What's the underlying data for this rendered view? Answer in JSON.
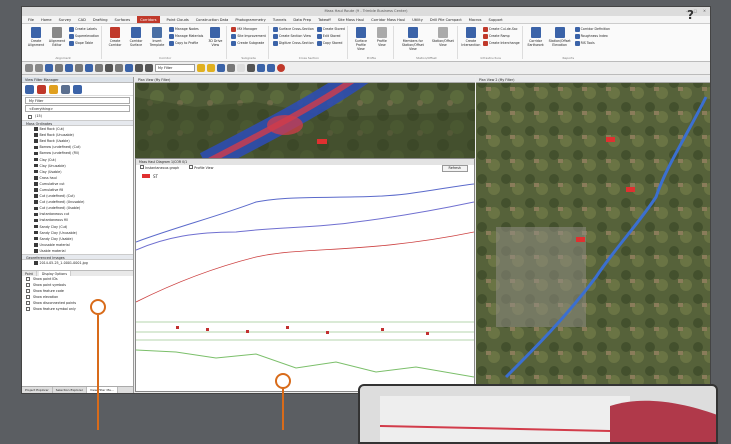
{
  "app": {
    "title": "Mass Haul Route (9 - Trimble Business Center)"
  },
  "menu": [
    "File",
    "Home",
    "Survey",
    "CAD",
    "Drafting",
    "Surfaces",
    "Corridors",
    "Point Clouds",
    "Construction Data",
    "Photogrammetry",
    "Tunnels",
    "Data Prep",
    "Takeoff",
    "Site Mass Haul",
    "Corridor Mass Haul",
    "Utility",
    "Drill Pile Compact",
    "Macros",
    "Support"
  ],
  "menu_active_index": 6,
  "help_label": "?",
  "ribbon": {
    "create_alignment": "Create Alignment",
    "alignment_editor": "Alignment Editor",
    "labels": [
      "Create Labels",
      "Superelevation",
      "Slope Table"
    ],
    "create_corridor": "Create Corridor",
    "corridor_surface": "Corridor Surface",
    "insert_template": "Insert Template",
    "nodes": [
      "Manage Nodes",
      "Manage Materials",
      "Copy to Profile"
    ],
    "drive_view": "3D Drive View",
    "mx": [
      "MX Manager",
      "Site Improvement",
      "Create Subgrade"
    ],
    "sections": [
      "Surface Cross-Section",
      "Create Section View",
      "Digitize Cross-Section"
    ],
    "stored": [
      "Create Stored",
      "Edit Stored",
      "Copy Stored"
    ],
    "surface_profile": "Surface Profile View",
    "profile_view": "Profile View",
    "members": "Members for Station/Offset View",
    "station_offset": "Station/Offset View",
    "create_intersection": "Create Intersection",
    "ramps": [
      "Create Cul-de-Sac",
      "Create Ramp",
      "Create Interchange"
    ],
    "corridor_earthwork": "Corridor Earthwork",
    "station_elevation": "Station/Offset Elevation",
    "reports": [
      "Corridor Definition",
      "Roughness Index",
      "RIS Tools"
    ],
    "groups": [
      "Alignment",
      "Corridor",
      "Subgrade",
      "Cross Section",
      "Profile",
      "Station/Offset",
      "Infrastructure",
      "Reports"
    ]
  },
  "toolbar": {
    "filter_value": "My Filter"
  },
  "left_panel": {
    "title": "View Filter Manager",
    "filter_label": "My Filter",
    "everything": "<Everything>",
    "first_item": "(15)",
    "group_materials": "Mass Ordinates",
    "materials": [
      "Bed Rock (Cut)",
      "Bed Rock (Unusable)",
      "Bed Rock (Usable)",
      "Borrow (undefined) (Cut)",
      "Borrow (undefined) (Fill)",
      "Clay (Cut)",
      "Clay (Unusable)",
      "Clay (Usable)",
      "Cross haul",
      "Cumulative cut",
      "Cumulative fill",
      "Cut (undefined) (Cut)",
      "Cut (undefined) (Unusable)",
      "Cut (undefined) (Usable)",
      "Instantaneous cut",
      "Instantaneous fill",
      "Sandy Clay (Cut)",
      "Sandy Clay (Unusable)",
      "Sandy Clay (Usable)",
      "Unusable material",
      "Usable material"
    ],
    "group_images": "Georeferenced Images",
    "image_item": "2014-05-25_1-0001-0001.jpg",
    "display_tabs": [
      "Point",
      "Display Options"
    ],
    "options": [
      "Show point IDs",
      "Show point symbols",
      "Show feature code",
      "Show elevation",
      "Show disconnected points",
      "Show feature symbol only"
    ],
    "bottom_tabs": [
      "Project Explorer",
      "Selection Explorer",
      "View Filter Ma..."
    ]
  },
  "views": {
    "plan_left": "Plan View (My Filter)",
    "plan_right": "Plan View 2 (My Filter)",
    "mass_haul": "Mass Haul Diagram 1/COR 0/1",
    "mh_options": [
      "Instantaneous graph",
      "Profile View"
    ],
    "refresh": "Refresh",
    "legend": "ST"
  }
}
